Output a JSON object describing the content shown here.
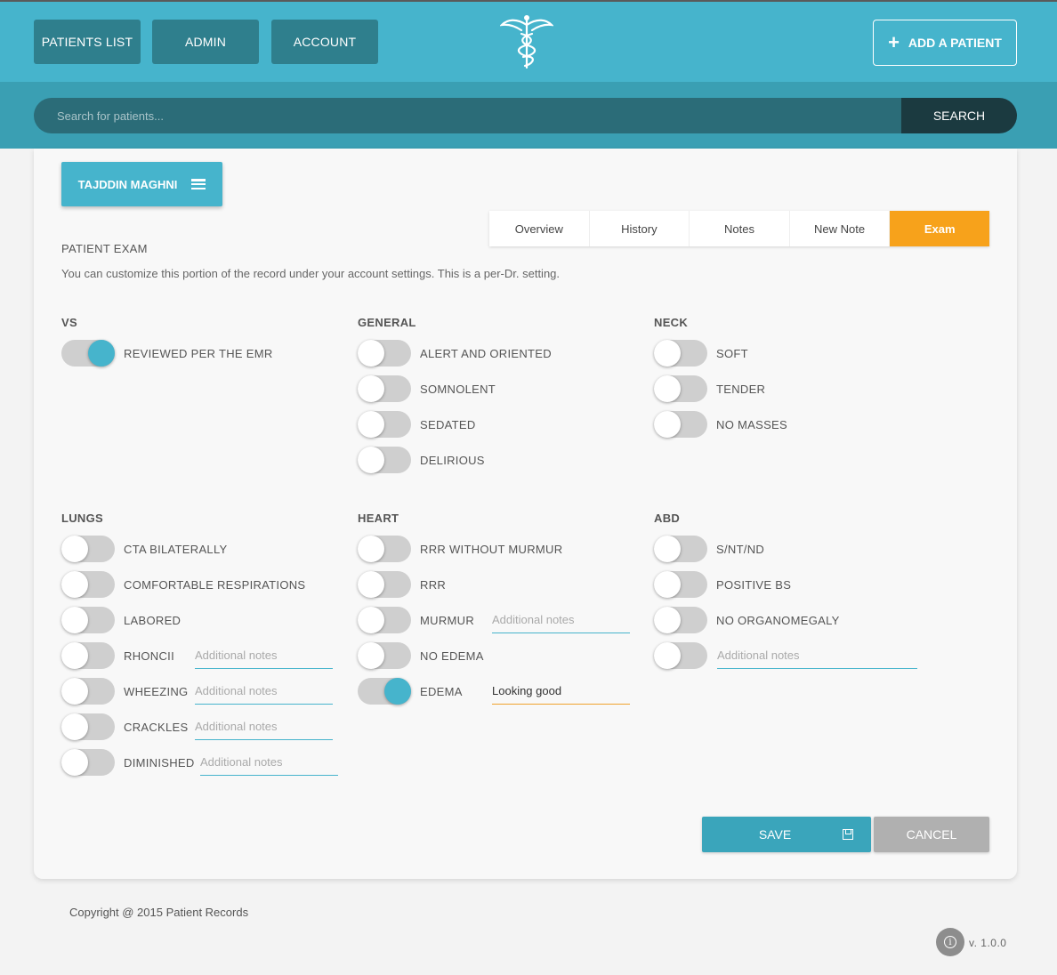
{
  "nav": {
    "patients_list": "PATIENTS LIST",
    "admin": "ADMIN",
    "account": "ACCOUNT",
    "add_patient": "ADD A PATIENT"
  },
  "search": {
    "placeholder": "Search for patients...",
    "button": "SEARCH"
  },
  "patient": {
    "name": "TAJDDIN MAGHNI"
  },
  "tabs": [
    "Overview",
    "History",
    "Notes",
    "New Note",
    "Exam"
  ],
  "active_tab": "Exam",
  "exam": {
    "title": "PATIENT EXAM",
    "description": "You can customize this portion of the record under your account settings. This is a per-Dr. setting.",
    "note_placeholder": "Additional notes",
    "groups": {
      "vs": {
        "title": "VS",
        "items": [
          {
            "label": "REVIEWED PER THE EMR",
            "on": true
          }
        ]
      },
      "general": {
        "title": "GENERAL",
        "items": [
          {
            "label": "ALERT AND ORIENTED",
            "on": false
          },
          {
            "label": "SOMNOLENT",
            "on": false
          },
          {
            "label": "SEDATED",
            "on": false
          },
          {
            "label": "DELIRIOUS",
            "on": false
          }
        ]
      },
      "neck": {
        "title": "NECK",
        "items": [
          {
            "label": "SOFT",
            "on": false
          },
          {
            "label": "TENDER",
            "on": false
          },
          {
            "label": "NO MASSES",
            "on": false
          }
        ]
      },
      "lungs": {
        "title": "LUNGS",
        "items": [
          {
            "label": "CTA BILATERALLY",
            "on": false
          },
          {
            "label": "COMFORTABLE RESPIRATIONS",
            "on": false
          },
          {
            "label": "LABORED",
            "on": false
          },
          {
            "label": "RHONCII",
            "on": false
          },
          {
            "label": "WHEEZING",
            "on": false
          },
          {
            "label": "CRACKLES",
            "on": false
          },
          {
            "label": "DIMINISHED",
            "on": false
          }
        ]
      },
      "heart": {
        "title": "HEART",
        "items": [
          {
            "label": "RRR WITHOUT MURMUR",
            "on": false
          },
          {
            "label": "RRR",
            "on": false
          },
          {
            "label": "MURMUR",
            "on": false
          },
          {
            "label": "NO EDEMA",
            "on": false
          },
          {
            "label": "EDEMA",
            "on": true,
            "note_value": "Looking good"
          }
        ]
      },
      "abd": {
        "title": "ABD",
        "items": [
          {
            "label": "S/NT/ND",
            "on": false
          },
          {
            "label": "POSITIVE BS",
            "on": false
          },
          {
            "label": "NO ORGANOMEGALY",
            "on": false
          },
          {
            "label": "",
            "on": false
          }
        ]
      }
    }
  },
  "actions": {
    "save": "SAVE",
    "cancel": "CANCEL"
  },
  "footer": {
    "copyright": "Copyright @ 2015 Patient Records",
    "version": "v. 1.0.0"
  },
  "colors": {
    "primary": "#46b4cc",
    "dark": "#2f7f8d",
    "accent": "#f7a21b",
    "toggle_off": "#cfcfcf"
  }
}
